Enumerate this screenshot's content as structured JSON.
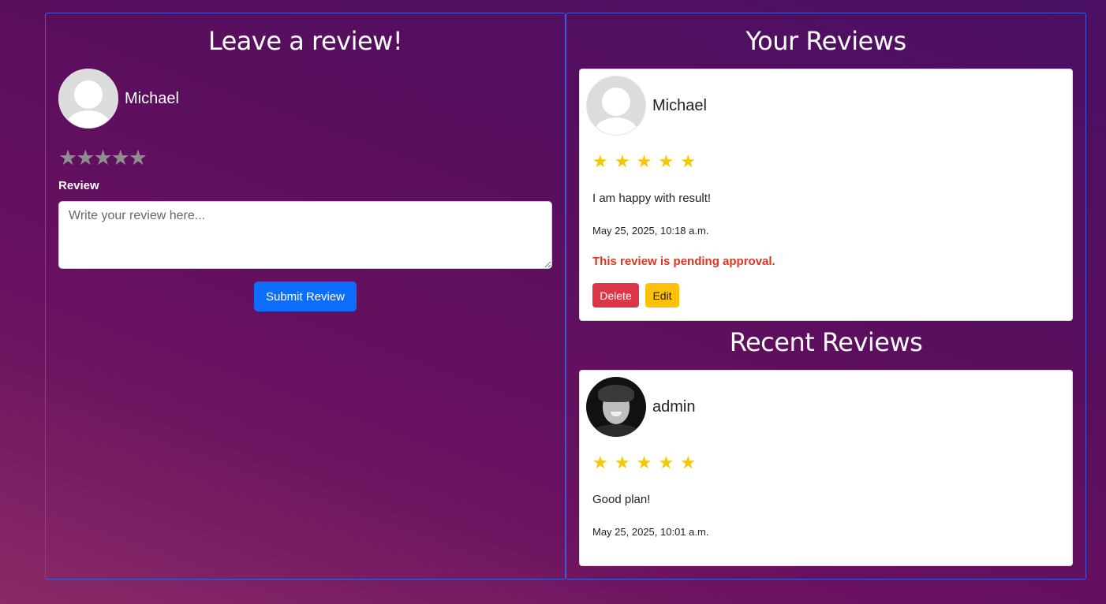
{
  "leave_review": {
    "title": "Leave a review!",
    "user_name": "Michael",
    "stars": [
      "★",
      "★",
      "★",
      "★",
      "★"
    ],
    "review_label": "Review",
    "textarea_placeholder": "Write your review here...",
    "submit_label": "Submit Review"
  },
  "your_reviews": {
    "title": "Your Reviews",
    "card": {
      "user_name": "Michael",
      "stars": "★ ★ ★ ★ ★",
      "text": "I am happy with result!",
      "date": "May 25, 2025, 10:18 a.m.",
      "pending": "This review is pending approval.",
      "delete_label": "Delete",
      "edit_label": "Edit"
    }
  },
  "recent_reviews": {
    "title": "Recent Reviews",
    "card": {
      "user_name": "admin",
      "stars": "★ ★ ★ ★ ★",
      "text": "Good plan!",
      "date": "May 25, 2025, 10:01 a.m."
    }
  },
  "colors": {
    "primary": "#0d6efd",
    "danger": "#dc3545",
    "warning": "#ffc107",
    "star_filled": "#f5c800",
    "star_empty": "#8e8e8e",
    "pending_text": "#e0341f"
  },
  "icons": {
    "default_avatar": "user-silhouette-icon",
    "admin_avatar": "profile-photo"
  }
}
